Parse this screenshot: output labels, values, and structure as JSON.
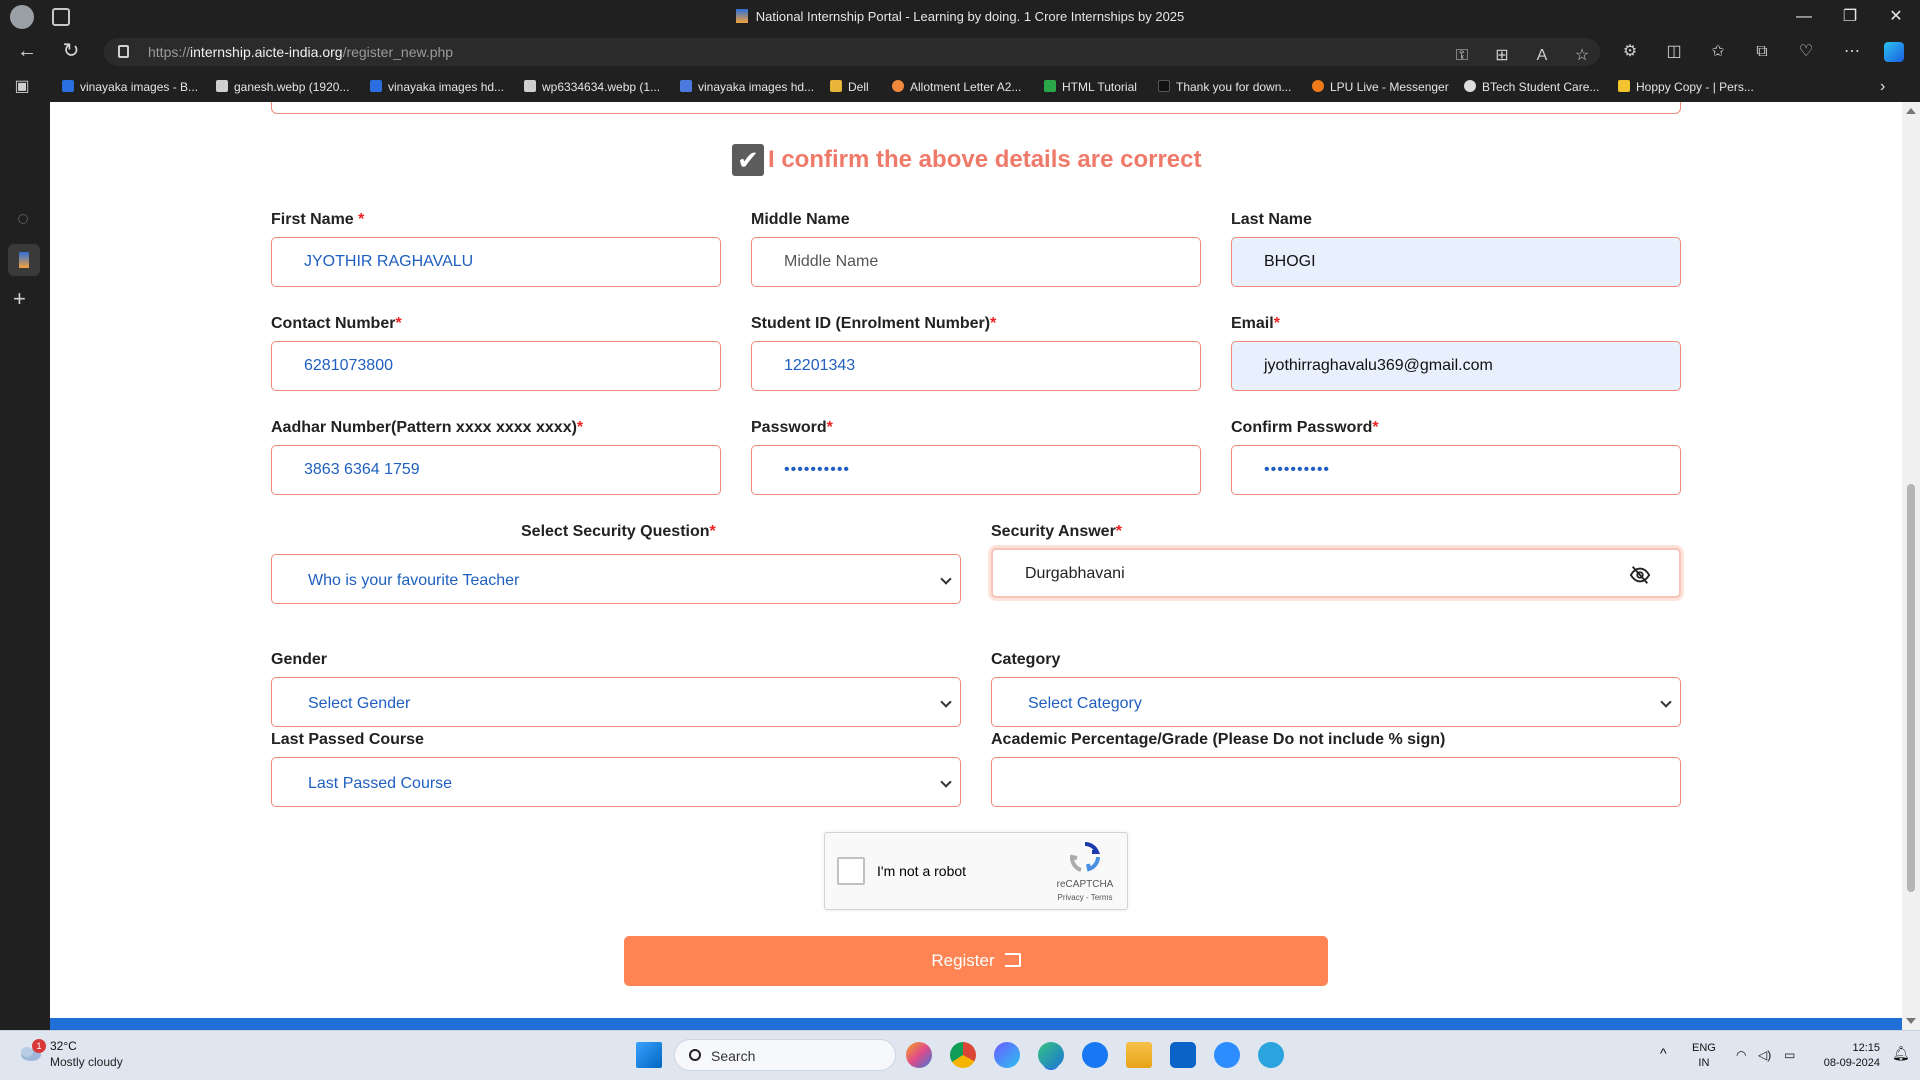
{
  "browser": {
    "window_title": "National Internship Portal - Learning by doing. 1 Crore Internships by 2025",
    "url_scheme": "https://",
    "url_host": "internship.aicte-india.org",
    "url_path": "/register_new.php",
    "bookmarks": [
      {
        "label": "vinayaka images - B...",
        "color": "#2a6ee0"
      },
      {
        "label": "ganesh.webp (1920...",
        "color": "#cfcfcf"
      },
      {
        "label": "vinayaka images hd...",
        "color": "#2a6ee0"
      },
      {
        "label": "wp6334634.webp (1...",
        "color": "#cfcfcf"
      },
      {
        "label": "vinayaka images hd...",
        "color": "#4c7be0"
      },
      {
        "label": "Dell",
        "color": "#e8b53a"
      },
      {
        "label": "Allotment Letter A2...",
        "color": "#f08a3a"
      },
      {
        "label": "HTML Tutorial",
        "color": "#2aa84a"
      },
      {
        "label": "Thank you for down...",
        "color": "#111111"
      },
      {
        "label": "LPU Live - Messenger",
        "color": "#f07a1a"
      },
      {
        "label": "BTech Student Care...",
        "color": "#dddddd"
      },
      {
        "label": "Hoppy Copy - | Pers...",
        "color": "#f4c430"
      }
    ]
  },
  "form": {
    "confirm_text": "I confirm the above details are correct",
    "required_mark": "*",
    "first_name": {
      "label": "First Name",
      "value": "JYOTHIR RAGHAVALU"
    },
    "middle_name": {
      "label": "Middle Name",
      "placeholder": "Middle Name"
    },
    "last_name": {
      "label": "Last Name",
      "value": "BHOGI"
    },
    "contact": {
      "label": "Contact Number",
      "value": "6281073800"
    },
    "student_id": {
      "label": "Student ID (Enrolment Number)",
      "value": "12201343"
    },
    "email": {
      "label": "Email",
      "value": "jyothirraghavalu369@gmail.com"
    },
    "aadhar": {
      "label": "Aadhar Number(Pattern xxxx xxxx xxxx)",
      "value": "3863 6364 1759"
    },
    "password": {
      "label": "Password",
      "value": "••••••••••"
    },
    "confirm_password": {
      "label": "Confirm Password",
      "value": "••••••••••"
    },
    "security_question": {
      "label": "Select Security Question",
      "value": "Who is your favourite Teacher"
    },
    "security_answer": {
      "label": "Security Answer",
      "value": "Durgabhavani"
    },
    "gender": {
      "label": "Gender",
      "value": "Select Gender"
    },
    "category": {
      "label": "Category",
      "value": "Select Category"
    },
    "last_course": {
      "label": "Last Passed Course",
      "value": "Last Passed Course"
    },
    "academic": {
      "label": "Academic Percentage/Grade (Please Do not include % sign)",
      "value": ""
    },
    "captcha": {
      "text": "I'm not a robot",
      "brand": "reCAPTCHA",
      "terms": "Privacy - Terms"
    },
    "register_label": "Register"
  },
  "colors": {
    "accent": "#fe8553",
    "field_border": "#f08a7a",
    "confirm_text": "#f07a6a",
    "value_text": "#1f5fbf",
    "footer_bar": "#1f6fd6"
  },
  "taskbar": {
    "temperature": "32°C",
    "weather": "Mostly cloudy",
    "weather_badge": "1",
    "search_label": "Search",
    "lang_top": "ENG",
    "lang_bottom": "IN",
    "time": "12:15",
    "date": "08-09-2024"
  }
}
